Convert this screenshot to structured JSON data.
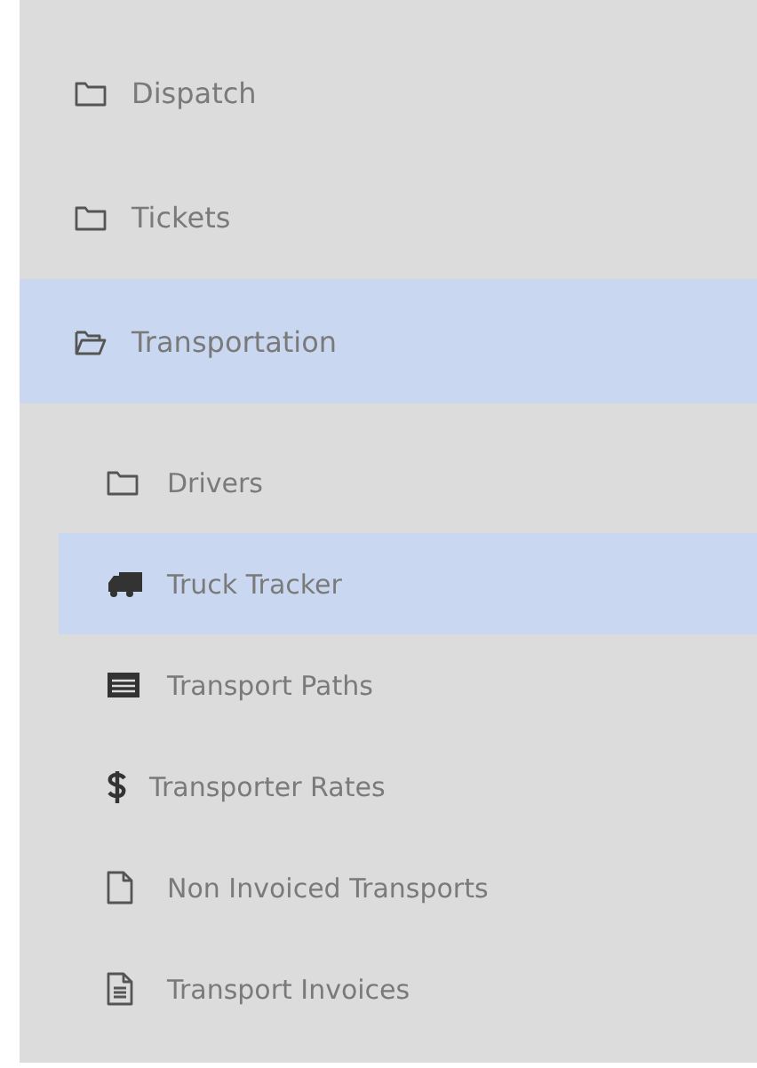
{
  "nav": [
    {
      "label": "Dispatch",
      "kind": "folder",
      "selected": false,
      "expanded": false
    },
    {
      "label": "Tickets",
      "kind": "folder",
      "selected": false,
      "expanded": false
    },
    {
      "label": "Transportation",
      "kind": "folder",
      "selected": true,
      "expanded": true,
      "children": [
        {
          "label": "Drivers",
          "kind": "folder",
          "selected": false
        },
        {
          "label": "Truck Tracker",
          "kind": "truck",
          "selected": true
        },
        {
          "label": "Transport Paths",
          "kind": "list",
          "selected": false
        },
        {
          "label": "Transporter Rates",
          "kind": "dollar",
          "selected": false
        },
        {
          "label": "Non Invoiced Transports",
          "kind": "file",
          "selected": false
        },
        {
          "label": "Transport Invoices",
          "kind": "document",
          "selected": false
        }
      ]
    }
  ]
}
